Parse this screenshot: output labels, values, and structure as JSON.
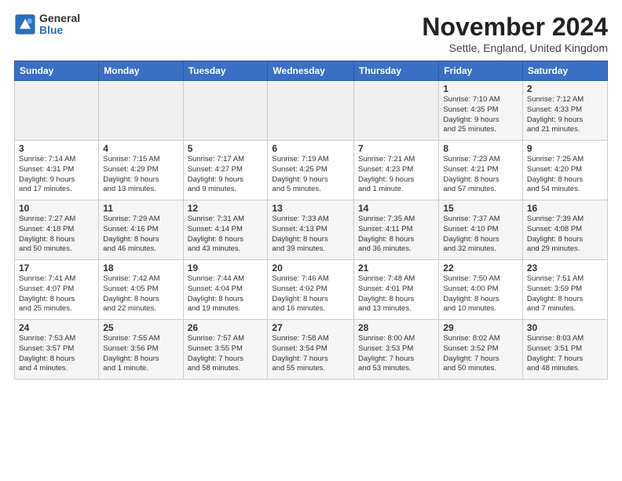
{
  "header": {
    "logo_general": "General",
    "logo_blue": "Blue",
    "month_title": "November 2024",
    "location": "Settle, England, United Kingdom"
  },
  "weekdays": [
    "Sunday",
    "Monday",
    "Tuesday",
    "Wednesday",
    "Thursday",
    "Friday",
    "Saturday"
  ],
  "weeks": [
    [
      {
        "day": "",
        "info": ""
      },
      {
        "day": "",
        "info": ""
      },
      {
        "day": "",
        "info": ""
      },
      {
        "day": "",
        "info": ""
      },
      {
        "day": "",
        "info": ""
      },
      {
        "day": "1",
        "info": "Sunrise: 7:10 AM\nSunset: 4:35 PM\nDaylight: 9 hours\nand 25 minutes."
      },
      {
        "day": "2",
        "info": "Sunrise: 7:12 AM\nSunset: 4:33 PM\nDaylight: 9 hours\nand 21 minutes."
      }
    ],
    [
      {
        "day": "3",
        "info": "Sunrise: 7:14 AM\nSunset: 4:31 PM\nDaylight: 9 hours\nand 17 minutes."
      },
      {
        "day": "4",
        "info": "Sunrise: 7:15 AM\nSunset: 4:29 PM\nDaylight: 9 hours\nand 13 minutes."
      },
      {
        "day": "5",
        "info": "Sunrise: 7:17 AM\nSunset: 4:27 PM\nDaylight: 9 hours\nand 9 minutes."
      },
      {
        "day": "6",
        "info": "Sunrise: 7:19 AM\nSunset: 4:25 PM\nDaylight: 9 hours\nand 5 minutes."
      },
      {
        "day": "7",
        "info": "Sunrise: 7:21 AM\nSunset: 4:23 PM\nDaylight: 9 hours\nand 1 minute."
      },
      {
        "day": "8",
        "info": "Sunrise: 7:23 AM\nSunset: 4:21 PM\nDaylight: 8 hours\nand 57 minutes."
      },
      {
        "day": "9",
        "info": "Sunrise: 7:25 AM\nSunset: 4:20 PM\nDaylight: 8 hours\nand 54 minutes."
      }
    ],
    [
      {
        "day": "10",
        "info": "Sunrise: 7:27 AM\nSunset: 4:18 PM\nDaylight: 8 hours\nand 50 minutes."
      },
      {
        "day": "11",
        "info": "Sunrise: 7:29 AM\nSunset: 4:16 PM\nDaylight: 8 hours\nand 46 minutes."
      },
      {
        "day": "12",
        "info": "Sunrise: 7:31 AM\nSunset: 4:14 PM\nDaylight: 8 hours\nand 43 minutes."
      },
      {
        "day": "13",
        "info": "Sunrise: 7:33 AM\nSunset: 4:13 PM\nDaylight: 8 hours\nand 39 minutes."
      },
      {
        "day": "14",
        "info": "Sunrise: 7:35 AM\nSunset: 4:11 PM\nDaylight: 8 hours\nand 36 minutes."
      },
      {
        "day": "15",
        "info": "Sunrise: 7:37 AM\nSunset: 4:10 PM\nDaylight: 8 hours\nand 32 minutes."
      },
      {
        "day": "16",
        "info": "Sunrise: 7:39 AM\nSunset: 4:08 PM\nDaylight: 8 hours\nand 29 minutes."
      }
    ],
    [
      {
        "day": "17",
        "info": "Sunrise: 7:41 AM\nSunset: 4:07 PM\nDaylight: 8 hours\nand 25 minutes."
      },
      {
        "day": "18",
        "info": "Sunrise: 7:42 AM\nSunset: 4:05 PM\nDaylight: 8 hours\nand 22 minutes."
      },
      {
        "day": "19",
        "info": "Sunrise: 7:44 AM\nSunset: 4:04 PM\nDaylight: 8 hours\nand 19 minutes."
      },
      {
        "day": "20",
        "info": "Sunrise: 7:46 AM\nSunset: 4:02 PM\nDaylight: 8 hours\nand 16 minutes."
      },
      {
        "day": "21",
        "info": "Sunrise: 7:48 AM\nSunset: 4:01 PM\nDaylight: 8 hours\nand 13 minutes."
      },
      {
        "day": "22",
        "info": "Sunrise: 7:50 AM\nSunset: 4:00 PM\nDaylight: 8 hours\nand 10 minutes."
      },
      {
        "day": "23",
        "info": "Sunrise: 7:51 AM\nSunset: 3:59 PM\nDaylight: 8 hours\nand 7 minutes."
      }
    ],
    [
      {
        "day": "24",
        "info": "Sunrise: 7:53 AM\nSunset: 3:57 PM\nDaylight: 8 hours\nand 4 minutes."
      },
      {
        "day": "25",
        "info": "Sunrise: 7:55 AM\nSunset: 3:56 PM\nDaylight: 8 hours\nand 1 minute."
      },
      {
        "day": "26",
        "info": "Sunrise: 7:57 AM\nSunset: 3:55 PM\nDaylight: 7 hours\nand 58 minutes."
      },
      {
        "day": "27",
        "info": "Sunrise: 7:58 AM\nSunset: 3:54 PM\nDaylight: 7 hours\nand 55 minutes."
      },
      {
        "day": "28",
        "info": "Sunrise: 8:00 AM\nSunset: 3:53 PM\nDaylight: 7 hours\nand 53 minutes."
      },
      {
        "day": "29",
        "info": "Sunrise: 8:02 AM\nSunset: 3:52 PM\nDaylight: 7 hours\nand 50 minutes."
      },
      {
        "day": "30",
        "info": "Sunrise: 8:03 AM\nSunset: 3:51 PM\nDaylight: 7 hours\nand 48 minutes."
      }
    ]
  ]
}
